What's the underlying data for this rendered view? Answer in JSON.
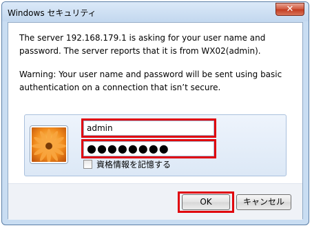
{
  "window": {
    "title": "Windows セキュリティ",
    "close_label": "✕"
  },
  "message": {
    "line1": "The server 192.168.179.1 is asking for your user name and password. The server reports that it is from WX02(admin).",
    "warning": "Warning: Your user name and password will be sent using basic authentication on a connection that isn’t secure."
  },
  "credentials": {
    "username": "admin",
    "password_mask": "●●●●●●●●",
    "remember_label": "資格情報を記憶する",
    "remember_checked": false
  },
  "buttons": {
    "ok": "OK",
    "cancel": "キャンセル"
  },
  "colors": {
    "highlight": "#e0000b",
    "window_frame": "#c9ddf2"
  },
  "icons": {
    "avatar": "flower-avatar-icon",
    "checkbox": "checkbox-icon"
  }
}
